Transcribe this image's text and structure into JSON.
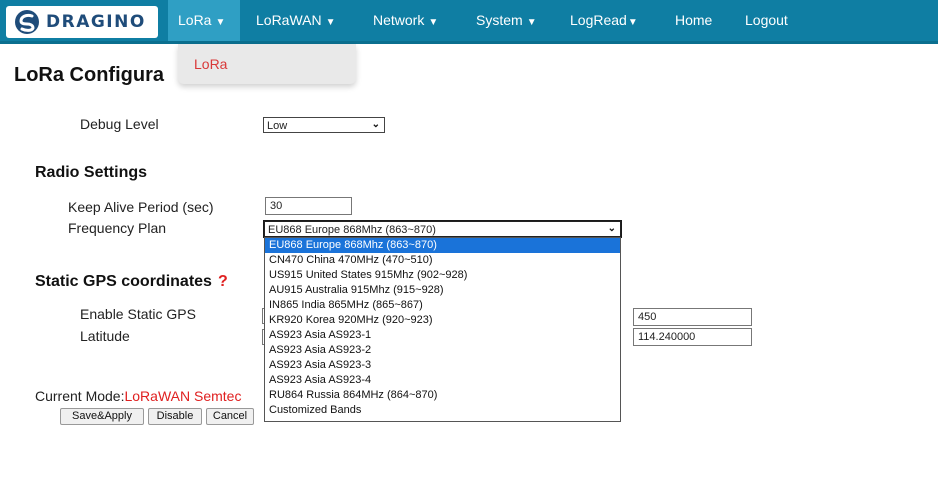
{
  "brand": {
    "name": "DRAGINO",
    "logo_color": "#1f4c7a"
  },
  "nav": {
    "bg_color": "#0f7ea3",
    "items": [
      {
        "label": "LoRa",
        "has_caret": true,
        "active": true
      },
      {
        "label": "LoRaWAN",
        "has_caret": true
      },
      {
        "label": "Network",
        "has_caret": true
      },
      {
        "label": "System",
        "has_caret": true
      },
      {
        "label": "LogRead",
        "has_caret": true
      },
      {
        "label": "Home"
      },
      {
        "label": "Logout"
      }
    ],
    "caret": "▼",
    "open_menu": {
      "items": [
        "LoRa"
      ]
    }
  },
  "page": {
    "title": "LoRa Configura"
  },
  "debug": {
    "label": "Debug Level",
    "value": "Low"
  },
  "radio": {
    "heading": "Radio Settings",
    "keepalive_label": "Keep Alive Period (sec)",
    "keepalive_value": "30",
    "freq_label": "Frequency Plan",
    "freq_value": "EU868 Europe 868Mhz (863~870)",
    "freq_options": [
      "EU868 Europe 868Mhz (863~870)",
      "CN470 China 470MHz (470~510)",
      "US915 United States 915Mhz (902~928)",
      "AU915 Australia 915Mhz (915~928)",
      "IN865 India 865MHz (865~867)",
      "KR920 Korea 920MHz (920~923)",
      "AS923 Asia AS923-1",
      "AS923 Asia AS923-2",
      "AS923 Asia AS923-3",
      "AS923 Asia AS923-4",
      "RU864 Russia 864MHz (864~870)",
      "Customized Bands"
    ],
    "freq_selected_index": 0
  },
  "gps": {
    "heading": "Static GPS coordinates",
    "help": "?",
    "enable_label": "Enable Static GPS",
    "latitude_label": "Latitude",
    "altitude_value": "450",
    "longitude_value": "114.240000"
  },
  "mode": {
    "label": "Current Mode:",
    "value": "LoRaWAN Semtec"
  },
  "buttons": {
    "save": "Save&Apply",
    "disable": "Disable",
    "cancel": "Cancel"
  },
  "colors": {
    "accent_red": "#e02020",
    "selected_option": "#1a73d9"
  }
}
